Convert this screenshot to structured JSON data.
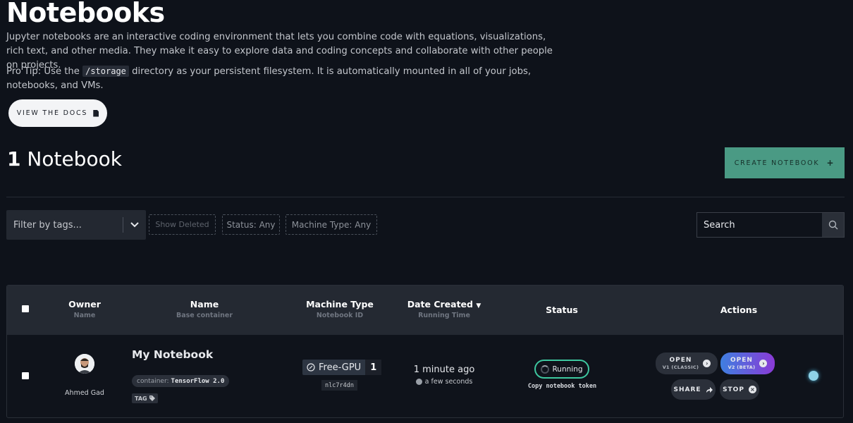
{
  "header": {
    "title": "Notebooks",
    "description": "Jupyter notebooks are an interactive coding environment that lets you combine code with equations, visualizations, rich text, and other media. They make it easy to explore data and coding concepts and collaborate with other people on projects.",
    "tip_prefix": "Pro Tip: Use the ",
    "tip_code": "/storage",
    "tip_suffix": " directory as your persistent filesystem. It is automatically mounted in all of your jobs, notebooks, and VMs.",
    "docs_button": "VIEW THE DOCS"
  },
  "summary": {
    "count": "1",
    "count_label": "Notebook",
    "create_button": "CREATE NOTEBOOK",
    "create_icon": "+"
  },
  "filters": {
    "tags_placeholder": "Filter by tags...",
    "show_deleted": "Show Deleted",
    "status": "Status: Any",
    "machine_type": "Machine Type: Any",
    "search_placeholder": "Search"
  },
  "table": {
    "columns": [
      {
        "label": "Owner",
        "sub": "Name"
      },
      {
        "label": "Name",
        "sub": "Base container"
      },
      {
        "label": "Machine Type",
        "sub": "Notebook ID"
      },
      {
        "label": "Date Created",
        "sub": "Running Time",
        "sort_icon": "▼"
      },
      {
        "label": "Status",
        "sub": ""
      },
      {
        "label": "Actions",
        "sub": ""
      }
    ],
    "rows": [
      {
        "owner": "Ahmed Gad",
        "name": "My Notebook",
        "container_label": "container:",
        "container": "TensorFlow 2.0",
        "tag": "TAG",
        "machine_type": "Free-GPU",
        "machine_count": "1",
        "notebook_id": "nlc7r4dn",
        "date_created": "1 minute ago",
        "running_time": "a few seconds",
        "status": "Running",
        "copy_token": "Copy notebook token",
        "actions": {
          "open_v1": "OPEN",
          "open_v1_sub": "V1 (CLASSIC)",
          "open_v2": "OPEN",
          "open_v2_sub": "V2 (BETA)",
          "share": "SHARE",
          "stop": "STOP"
        }
      }
    ]
  },
  "colors": {
    "background": "#0e121a",
    "create_button": "#4a9a84",
    "status_ring": "#3ec8a0",
    "open_v2_gradient_start": "#3f7fe0",
    "open_v2_gradient_end": "#8a3ad6"
  }
}
